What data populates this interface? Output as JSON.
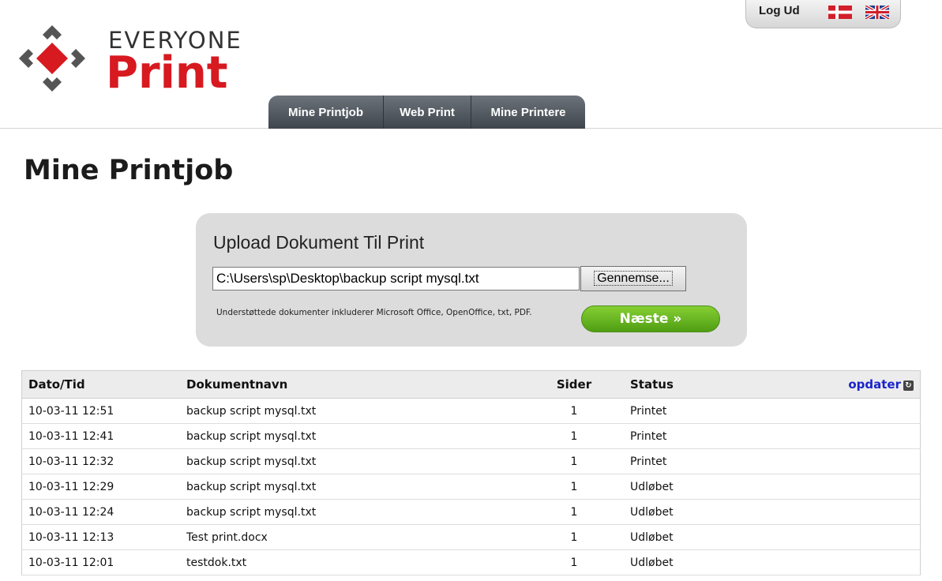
{
  "brand": {
    "line1": "EVERYONE",
    "line2": "Print"
  },
  "topbar": {
    "logout": "Log Ud"
  },
  "nav": [
    {
      "label": "Mine Printjob"
    },
    {
      "label": "Web Print"
    },
    {
      "label": "Mine Printere"
    }
  ],
  "page": {
    "title": "Mine Printjob"
  },
  "upload": {
    "title": "Upload Dokument Til Print",
    "file_value": "C:\\Users\\sp\\Desktop\\backup script mysql.txt",
    "browse_label": "Gennemse...",
    "supported_text": "Understøttede dokumenter inkluderer Microsoft Office, OpenOffice, txt, PDF.",
    "next_label": "Næste »"
  },
  "table": {
    "headers": {
      "date": "Dato/Tid",
      "doc": "Dokumentnavn",
      "pages": "Sider",
      "status": "Status"
    },
    "refresh_label": "opdater",
    "rows": [
      {
        "date": "10-03-11 12:51",
        "doc": "backup script mysql.txt",
        "pages": "1",
        "status": "Printet"
      },
      {
        "date": "10-03-11 12:41",
        "doc": "backup script mysql.txt",
        "pages": "1",
        "status": "Printet"
      },
      {
        "date": "10-03-11 12:32",
        "doc": "backup script mysql.txt",
        "pages": "1",
        "status": "Printet"
      },
      {
        "date": "10-03-11 12:29",
        "doc": "backup script mysql.txt",
        "pages": "1",
        "status": "Udløbet"
      },
      {
        "date": "10-03-11 12:24",
        "doc": "backup script mysql.txt",
        "pages": "1",
        "status": "Udløbet"
      },
      {
        "date": "10-03-11 12:13",
        "doc": "Test print.docx",
        "pages": "1",
        "status": "Udløbet"
      },
      {
        "date": "10-03-11 12:01",
        "doc": "testdok.txt",
        "pages": "1",
        "status": "Udløbet"
      }
    ]
  },
  "colors": {
    "brand_red": "#d71920",
    "nav_dark": "#4a5057",
    "next_green": "#5bb11f",
    "link_blue": "#1a24c9"
  },
  "icons": {
    "logo": "everyone-print-logo",
    "flag_dk": "danish-flag-icon",
    "flag_uk": "uk-flag-icon",
    "refresh": "refresh-icon"
  }
}
